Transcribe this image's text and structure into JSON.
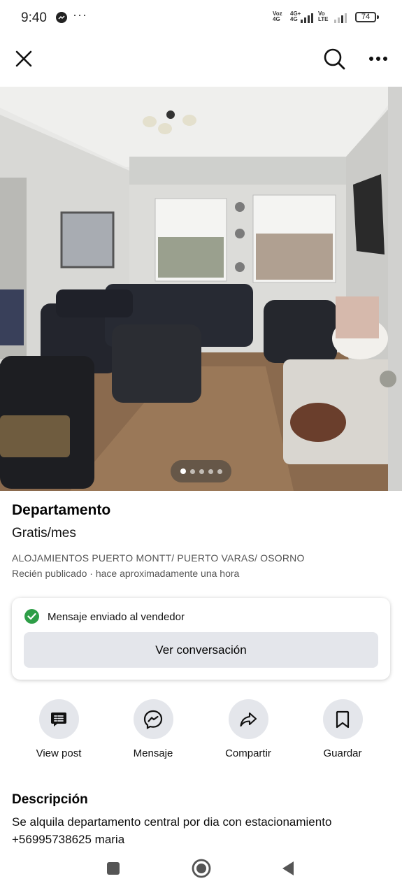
{
  "status_bar": {
    "time": "9:40",
    "more": "···",
    "sim1_top": "Voz",
    "sim1_bottom": "4G",
    "sim2_top": "4G+",
    "sim2_bottom": "4G",
    "sim3_top": "Vo",
    "sim3_bottom": "LTE",
    "battery": "74"
  },
  "topbar": {
    "close_icon": "close-icon",
    "search_icon": "search-icon",
    "more_icon": "more-icon"
  },
  "gallery": {
    "photo_count": 5,
    "active_index": 0
  },
  "listing": {
    "title": "Departamento",
    "price": "Gratis/mes",
    "location": "ALOJAMIENTOS PUERTO MONTT/ PUERTO VARAS/ OSORNO",
    "posted": "Recién publicado · hace aproximadamente una hora"
  },
  "message_card": {
    "status": "Mensaje enviado al vendedor",
    "button": "Ver conversación"
  },
  "actions": [
    {
      "label": "View post",
      "icon": "post-icon"
    },
    {
      "label": "Mensaje",
      "icon": "messenger-icon"
    },
    {
      "label": "Compartir",
      "icon": "share-icon"
    },
    {
      "label": "Guardar",
      "icon": "bookmark-icon"
    }
  ],
  "description": {
    "title": "Descripción",
    "text_line1": "Se alquila departamento central por dia con estacionamiento",
    "text_line2": "+56995738625 maria"
  },
  "colors": {
    "accent_green": "#2e9e47",
    "button_gray": "#e4e6eb"
  }
}
